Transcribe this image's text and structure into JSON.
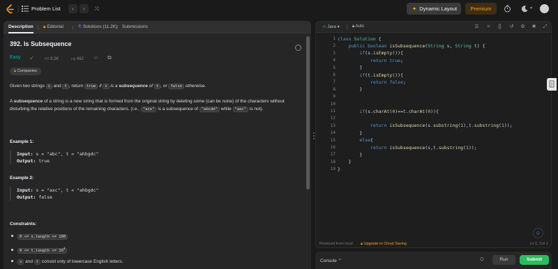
{
  "topbar": {
    "problem_list_label": "Problem List",
    "prev_glyph": "‹",
    "next_glyph": "›",
    "shuffle_glyph": "⤨",
    "dynamic_layout_label": "Dynamic Layout",
    "premium_label": "Premium",
    "accent_color": "#ffa116"
  },
  "left_tabs": [
    {
      "label": "Description",
      "icon": "description-icon",
      "active": true
    },
    {
      "label": "Editorial",
      "icon": "lock-icon"
    },
    {
      "label": "Solutions (11.2K)",
      "icon": "flask-icon"
    },
    {
      "label": "Submissions",
      "icon": "history-icon"
    }
  ],
  "problem": {
    "title": "392. Is Subsequence",
    "difficulty": "Easy",
    "difficulty_color": "#00b8a3",
    "likes": "9.2K",
    "dislikes": "492",
    "companies_label": "Companies",
    "statement": {
      "p1_a": "Given two strings ",
      "p1_s": "s",
      "p1_b": " and ",
      "p1_t": "t",
      "p1_c": ", return ",
      "p1_true": "true",
      "p1_d": " if ",
      "p1_s2": "s",
      "p1_e": " is a ",
      "p1_f": "subsequence",
      "p1_g": " of ",
      "p1_t2": "t",
      "p1_h": ", or ",
      "p1_false": "false",
      "p1_i": " otherwise.",
      "p2_a": "A ",
      "p2_b": "subsequence",
      "p2_c": " of a string is a new string that is formed from the original string by deleting some (can be none) of the characters without disturbing the relative positions of the remaining characters. (i.e., ",
      "p2_ace": "\"ace\"",
      "p2_d": " is a subsequence of ",
      "p2_abcde": "\"abcde\"",
      "p2_e": " while ",
      "p2_aec": "\"aec\"",
      "p2_f": " is not)."
    },
    "examples": [
      {
        "title": "Example 1:",
        "input_label": "Input:",
        "input": "s = \"abc\", t = \"ahbgdc\"",
        "output_label": "Output:",
        "output": "true"
      },
      {
        "title": "Example 2:",
        "input_label": "Input:",
        "input": "s = \"axc\", t = \"ahbgdc\"",
        "output_label": "Output:",
        "output": "false"
      }
    ],
    "constraints_title": "Constraints:",
    "constraints": [
      {
        "code": "0 <= s.length <= 100"
      },
      {
        "code": "0 <= t.length <= 10",
        "sup": "4"
      },
      {
        "code_s": "s",
        "mid": " and ",
        "code_t": "t",
        "rest": " consist only of lowercase English letters."
      }
    ]
  },
  "editor": {
    "language": "Java",
    "autosave": "Auto",
    "lines": [
      "class Solution {",
      "    public boolean isSubsequence(String s, String t) {",
      "        if(s.isEmpty()){",
      "            return true;",
      "        }",
      "        if(t.isEmpty()){",
      "            return false;",
      "        }",
      "",
      "",
      "        if(s.charAt(0)==t.charAt(0)){",
      "",
      "            return isSubsequence(s.substring(1),t.substring(1));",
      "        }",
      "        else{",
      "            return isSubsequence(s,t.substring(1));",
      "        }",
      "    }",
      "}"
    ],
    "restored_label": "Restored from local",
    "cloud_label": "Upgrade to Cloud Saving",
    "position_label": "Ln 1, Col 1"
  },
  "bottom": {
    "console_label": "Console",
    "run_label": "Run",
    "submit_label": "Submit",
    "submit_color": "#2cbb5d"
  }
}
